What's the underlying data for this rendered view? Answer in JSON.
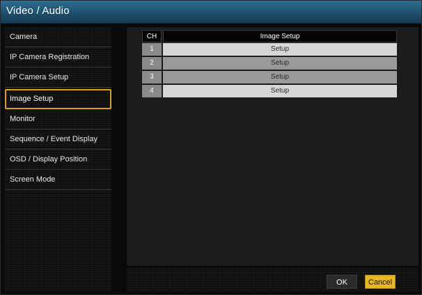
{
  "window": {
    "title": "Video / Audio"
  },
  "sidebar": {
    "items": [
      {
        "label": "Camera",
        "active": false
      },
      {
        "label": "IP Camera Registration",
        "active": false
      },
      {
        "label": "IP Camera Setup",
        "active": false
      },
      {
        "label": "Image Setup",
        "active": true
      },
      {
        "label": "Monitor",
        "active": false
      },
      {
        "label": "Sequence / Event Display",
        "active": false
      },
      {
        "label": "OSD / Display Position",
        "active": false
      },
      {
        "label": "Screen Mode",
        "active": false
      }
    ]
  },
  "table": {
    "headers": {
      "ch": "CH",
      "setup": "Image Setup"
    },
    "rows": [
      {
        "ch": "1",
        "button": "Setup"
      },
      {
        "ch": "2",
        "button": "Setup"
      },
      {
        "ch": "3",
        "button": "Setup"
      },
      {
        "ch": "4",
        "button": "Setup"
      }
    ]
  },
  "footer": {
    "ok_label": "OK",
    "cancel_label": "Cancel"
  },
  "colors": {
    "title_bar": "#1d4f6d",
    "active_border": "#d9a21b",
    "cancel_button": "#e7b624"
  }
}
